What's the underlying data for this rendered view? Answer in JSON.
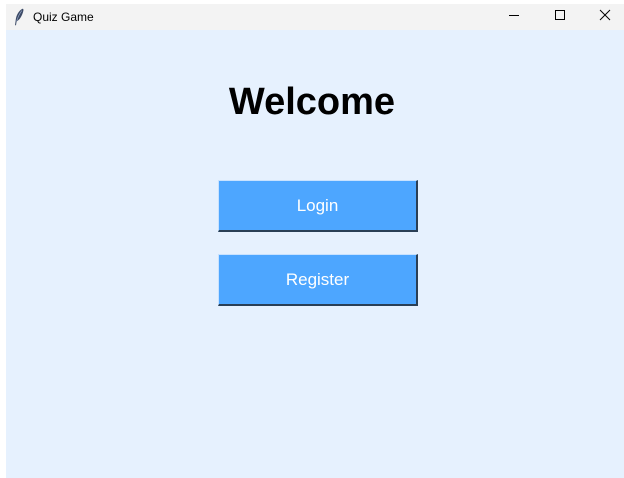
{
  "window": {
    "title": "Quiz Game",
    "app_icon": "feather-icon",
    "controls": {
      "minimize_icon": "minimize-icon",
      "maximize_icon": "maximize-icon",
      "close_icon": "close-icon"
    }
  },
  "main": {
    "heading": "Welcome",
    "login_label": "Login",
    "register_label": "Register"
  },
  "colors": {
    "background": "#e6f1fe",
    "button": "#4da6ff",
    "button_text": "#ffffff",
    "titlebar": "#f3f3f3"
  }
}
